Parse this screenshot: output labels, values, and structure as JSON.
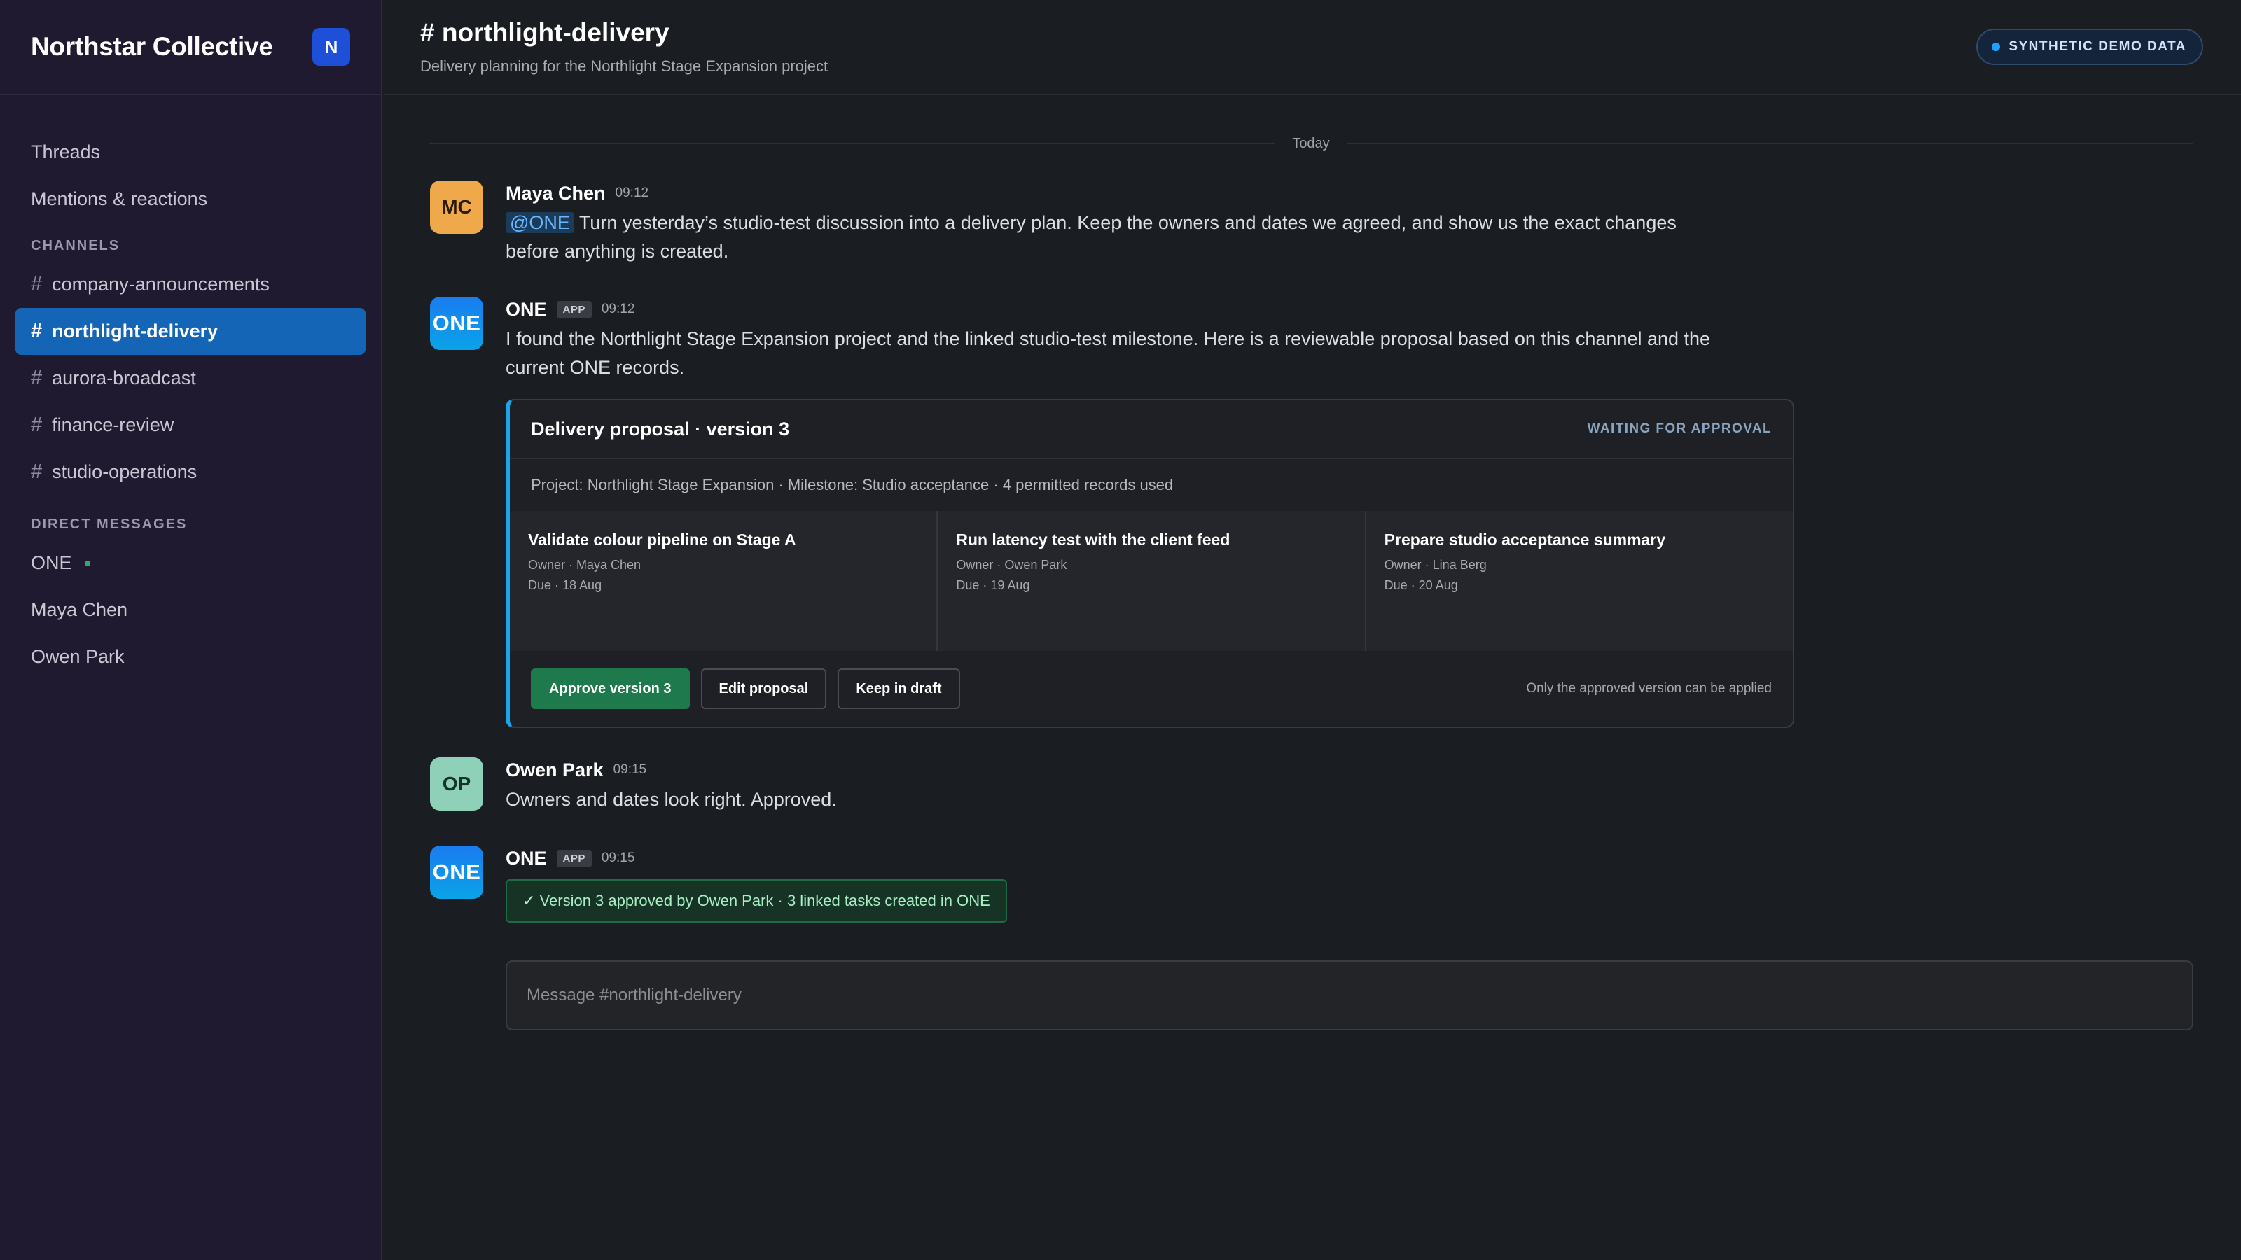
{
  "workspace": {
    "name": "Northstar Collective",
    "badge": "N"
  },
  "sidebar": {
    "nav": [
      "Threads",
      "Mentions & reactions"
    ],
    "channels_label": "CHANNELS",
    "channels": [
      {
        "name": "company-announcements",
        "active": false
      },
      {
        "name": "northlight-delivery",
        "active": true
      },
      {
        "name": "aurora-broadcast",
        "active": false
      },
      {
        "name": "finance-review",
        "active": false
      },
      {
        "name": "studio-operations",
        "active": false
      }
    ],
    "dm_label": "DIRECT MESSAGES",
    "dms": [
      "ONE",
      "Maya Chen",
      "Owen Park"
    ]
  },
  "header": {
    "title": "# northlight-delivery",
    "subtitle": "Delivery planning for the Northlight Stage Expansion project",
    "demo_badge": "SYNTHETIC DEMO DATA"
  },
  "divider": "Today",
  "messages": {
    "m1": {
      "initials": "MC",
      "author": "Maya Chen",
      "time": "09:12",
      "mention": "@ONE",
      "text": " Turn yesterday’s studio-test discussion into a delivery plan. Keep the owners and dates we agreed, and show us the exact changes before anything is created."
    },
    "m2": {
      "initials": "ONE",
      "author": "ONE",
      "tag": "APP",
      "time": "09:12",
      "text": "I found the Northlight Stage Expansion project and the linked studio-test milestone. Here is a reviewable proposal based on this channel and the current ONE records."
    },
    "m3": {
      "initials": "OP",
      "author": "Owen Park",
      "time": "09:15",
      "text": "Owners and dates look right. Approved."
    },
    "m4": {
      "initials": "ONE",
      "author": "ONE",
      "tag": "APP",
      "time": "09:15",
      "text": "✓ Version 3 approved by Owen Park · 3 linked tasks created in ONE"
    }
  },
  "proposal": {
    "title": "Delivery proposal · version 3",
    "status": "WAITING FOR APPROVAL",
    "scope": "Project: Northlight Stage Expansion · Milestone: Studio acceptance · 4 permitted records used",
    "tasks": [
      {
        "title": "Validate colour pipeline on Stage A",
        "owner": "Owner · Maya Chen",
        "due": "Due · 18 Aug"
      },
      {
        "title": "Run latency test with the client feed",
        "owner": "Owner · Owen Park",
        "due": "Due · 19 Aug"
      },
      {
        "title": "Prepare studio acceptance summary",
        "owner": "Owner · Lina Berg",
        "due": "Due · 20 Aug"
      }
    ],
    "buttons": {
      "approve": "Approve version 3",
      "edit": "Edit proposal",
      "draft": "Keep in draft"
    },
    "note": "Only the approved version can be applied"
  },
  "composer": {
    "placeholder": "Message #northlight-delivery"
  }
}
